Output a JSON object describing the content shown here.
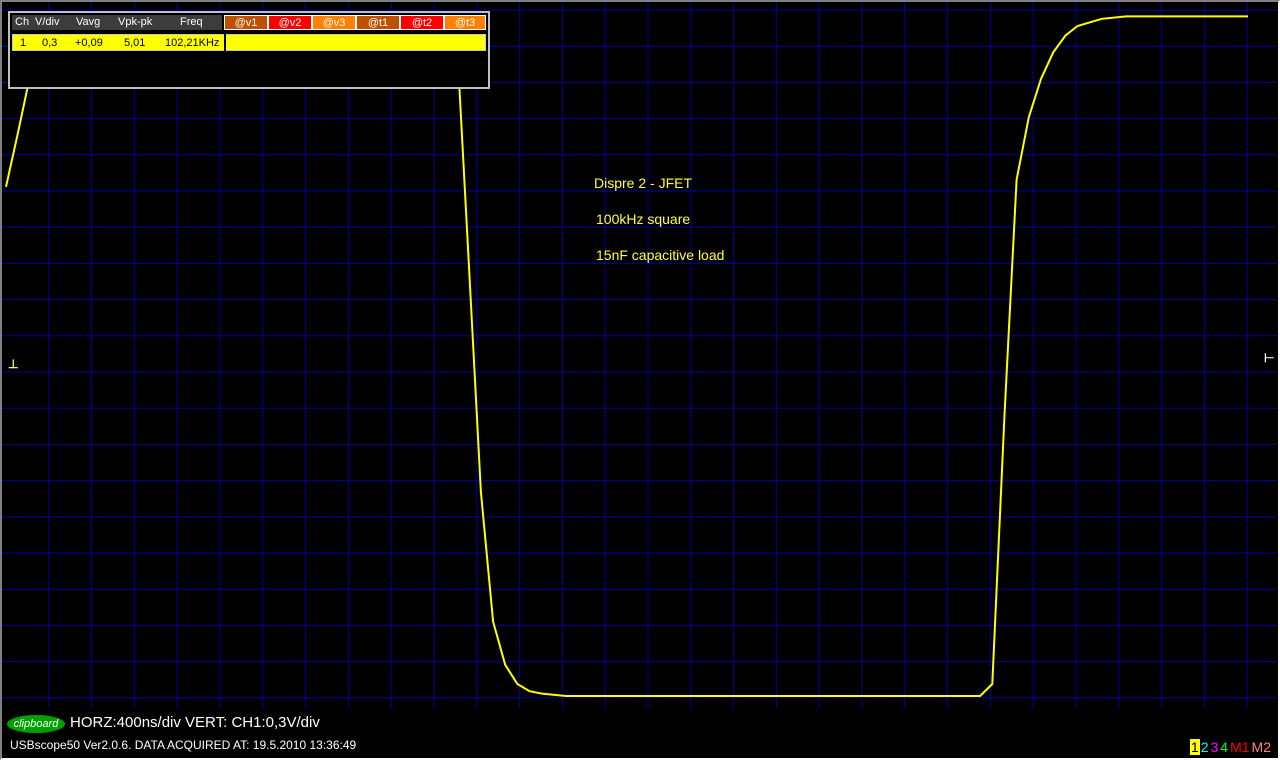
{
  "window": {
    "annotations": [
      "Dispre 2 - JFET",
      "100kHz square",
      "15nF capacitive load"
    ]
  },
  "measurement_table": {
    "headers": {
      "ch": "Ch",
      "vdiv": "V/div",
      "vavg": "Vavg",
      "vpkpk": "Vpk-pk",
      "freq": "Freq"
    },
    "cursor_buttons": [
      {
        "label": "@v1",
        "color": "#ff8000"
      },
      {
        "label": "@v2",
        "color": "#ff0000"
      },
      {
        "label": "@v3",
        "color": "#ff8000"
      },
      {
        "label": "@t1",
        "color": "#c05000"
      },
      {
        "label": "@t2",
        "color": "#ff0000"
      },
      {
        "label": "@t3",
        "color": "#ff8000"
      }
    ],
    "row": {
      "ch": "1",
      "vdiv": "0,3",
      "vavg": "+0,09",
      "vpkpk": "5,01",
      "freq": "102,21KHz"
    }
  },
  "status": {
    "clipboard_button": "clipboard",
    "scale_line": "HORZ:400ns/div VERT: CH1:0,3V/div",
    "info_line": "USBscope50 Ver2.0.6.  DATA ACQUIRED AT: 19.5.2010 13:36:49"
  },
  "channel_legend": [
    {
      "label": "1",
      "color": "#ffff00",
      "bg": "#000000",
      "text": "#000000"
    },
    {
      "label": "2",
      "color": "#00ffff"
    },
    {
      "label": "3",
      "color": "#ff00ff"
    },
    {
      "label": "4",
      "color": "#00ff00"
    },
    {
      "label": "M1",
      "color": "#ff0000"
    },
    {
      "label": "M2",
      "color": "#ff8080"
    }
  ],
  "colors": {
    "grid": "#0000a0",
    "trace": "#ffff00",
    "background": "#000000"
  },
  "chart_data": {
    "type": "line",
    "xlabel": "",
    "ylabel": "",
    "xlim": [
      0,
      5.1
    ],
    "ylim": [
      -8.1,
      6.6
    ],
    "x_units": "div (400ns/div)",
    "y_units": "div (0,3V/div)",
    "grid": true,
    "series": [
      {
        "x": [
          0.0,
          0.05,
          0.1,
          0.15,
          0.2,
          0.25,
          0.3,
          0.4,
          0.6,
          1.0,
          1.4,
          1.8,
          1.85,
          1.9,
          1.95,
          2.0,
          2.05,
          2.1,
          2.15,
          2.2,
          2.3,
          2.4,
          2.6,
          3.0,
          3.4,
          3.8,
          3.9,
          4.0,
          4.05,
          4.1,
          4.15,
          4.2,
          4.25,
          4.3,
          4.35,
          4.4,
          4.5,
          4.6,
          4.8,
          5.1
        ],
        "y": [
          2.75,
          3.9,
          5.1,
          5.7,
          5.9,
          5.95,
          6.0,
          6.0,
          6.0,
          6.0,
          6.0,
          6.0,
          5.95,
          1.2,
          -3.6,
          -6.3,
          -7.2,
          -7.6,
          -7.75,
          -7.8,
          -7.85,
          -7.85,
          -7.85,
          -7.85,
          -7.85,
          -7.85,
          -7.85,
          -7.85,
          -7.6,
          -2.0,
          2.9,
          4.2,
          5.0,
          5.55,
          5.9,
          6.1,
          6.25,
          6.3,
          6.3,
          6.3
        ]
      }
    ]
  }
}
